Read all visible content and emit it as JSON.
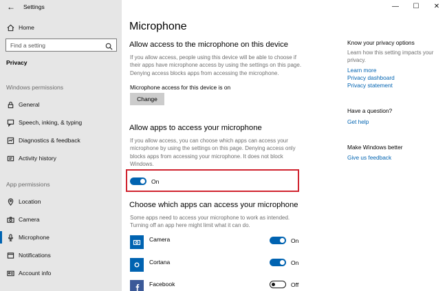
{
  "window": {
    "title": "Settings",
    "controls": {
      "minimize": "—",
      "maximize": "☐",
      "close": "✕"
    }
  },
  "sidebar": {
    "home_label": "Home",
    "search_placeholder": "Find a setting",
    "section_title": "Privacy",
    "windows_permissions_header": "Windows permissions",
    "windows_items": [
      {
        "label": "General",
        "icon": "lock-icon"
      },
      {
        "label": "Speech, inking, & typing",
        "icon": "speech-icon"
      },
      {
        "label": "Diagnostics & feedback",
        "icon": "diagnostics-icon"
      },
      {
        "label": "Activity history",
        "icon": "history-icon"
      }
    ],
    "app_permissions_header": "App permissions",
    "app_items": [
      {
        "label": "Location",
        "icon": "location-icon"
      },
      {
        "label": "Camera",
        "icon": "camera-icon"
      },
      {
        "label": "Microphone",
        "icon": "microphone-icon",
        "selected": true
      },
      {
        "label": "Notifications",
        "icon": "notifications-icon"
      },
      {
        "label": "Account info",
        "icon": "account-icon"
      }
    ]
  },
  "main": {
    "title": "Microphone",
    "device_section": {
      "heading": "Allow access to the microphone on this device",
      "description": "If you allow access, people using this device will be able to choose if their apps have microphone access by using the settings on this page. Denying access blocks apps from accessing the microphone.",
      "status": "Microphone access for this device is on",
      "button_label": "Change"
    },
    "apps_section": {
      "heading": "Allow apps to access your microphone",
      "description": "If you allow access, you can choose which apps can access your microphone by using the settings on this page. Denying access only blocks apps from accessing your microphone. It does not block Windows.",
      "toggle_state": "On"
    },
    "choose_section": {
      "heading": "Choose which apps can access your microphone",
      "description": "Some apps need to access your microphone to work as intended. Turning off an app here might limit what it can do.",
      "apps": [
        {
          "name": "Camera",
          "state": "On",
          "on": true
        },
        {
          "name": "Cortana",
          "state": "On",
          "on": true
        },
        {
          "name": "Facebook",
          "state": "Off",
          "on": false
        }
      ]
    }
  },
  "right_panel": {
    "privacy_heading": "Know your privacy options",
    "privacy_desc": "Learn how this setting impacts your privacy.",
    "links": [
      "Learn more",
      "Privacy dashboard",
      "Privacy statement"
    ],
    "question_heading": "Have a question?",
    "help_link": "Get help",
    "better_heading": "Make Windows better",
    "feedback_link": "Give us feedback"
  },
  "colors": {
    "accent": "#0063b1",
    "highlight": "#d0222e",
    "sidebar_bg": "#e6e6e6"
  }
}
